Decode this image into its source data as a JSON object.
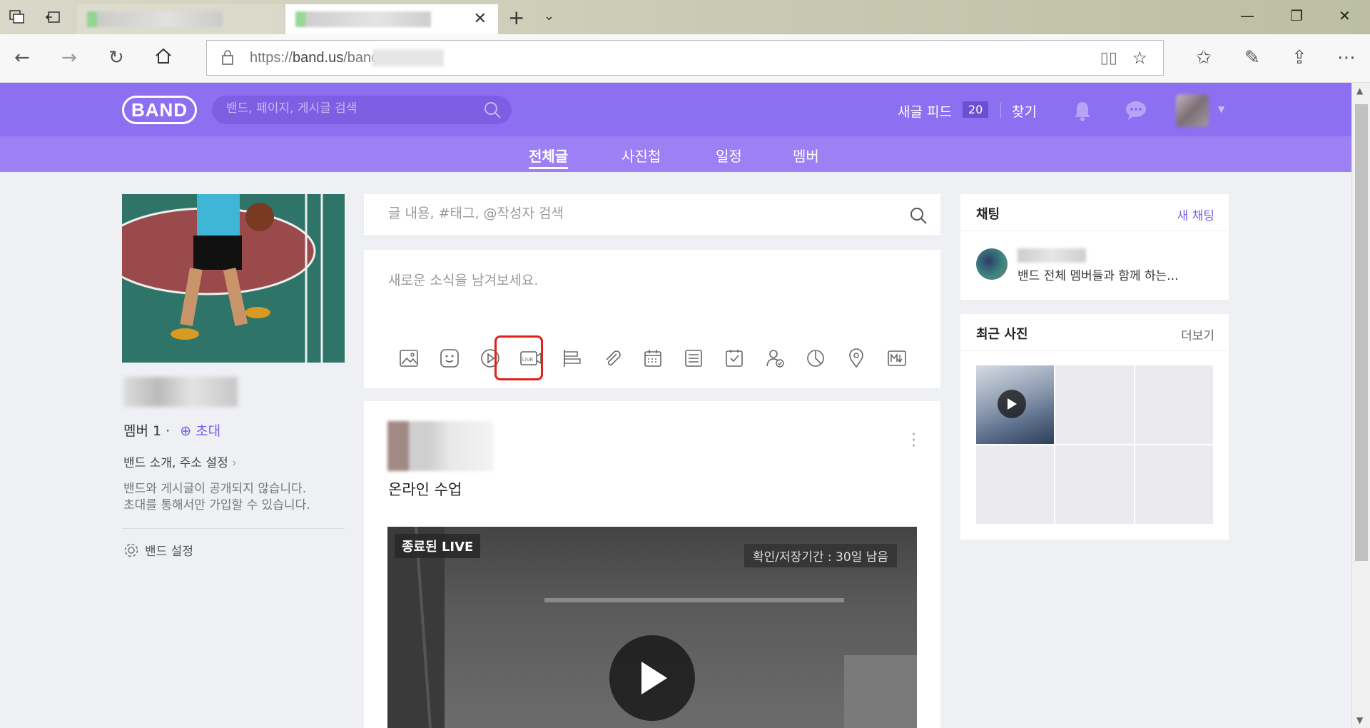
{
  "browser": {
    "url_prefix": "https://",
    "url_host": "band.us",
    "url_path": "/banc"
  },
  "band": {
    "logo": "BAND",
    "search_placeholder": "밴드, 페이지, 게시글 검색",
    "feed_label": "새글 피드",
    "feed_count": "20",
    "find_label": "찾기"
  },
  "subnav": {
    "tabs": [
      "전체글",
      "사진첩",
      "일정",
      "멤버"
    ],
    "active": "전체글"
  },
  "left": {
    "member_label": "멤버 1 ·",
    "invite_label": "초대",
    "intro_link": "밴드 소개, 주소 설정",
    "privacy_line1": "밴드와 게시글이 공개되지 않습니다.",
    "privacy_line2": "초대를 통해서만 가입할 수 있습니다.",
    "settings_label": "밴드 설정"
  },
  "center": {
    "post_search_placeholder": "글 내용, #태그, @작성자 검색",
    "composer_prompt": "새로운 소식을 남겨보세요.",
    "tools": [
      "image-icon",
      "sticker-icon",
      "video-icon",
      "live-icon",
      "text-style-icon",
      "attachment-icon",
      "calendar-icon",
      "checklist-icon",
      "todo-icon",
      "attendance-icon",
      "poll-icon",
      "location-icon",
      "markdown-icon"
    ],
    "post": {
      "title": "온라인 수업",
      "ended_badge": "종료된 LIVE",
      "expire_text": "확인/저장기간 : 30일 남음"
    }
  },
  "right": {
    "chat_title": "채팅",
    "new_chat": "새 채팅",
    "chat_desc": "밴드 전체 멤버들과 함께 하는...",
    "photos_title": "최근 사진",
    "photos_more": "더보기"
  },
  "colors": {
    "band_purple": "#8d6ff1",
    "subnav_purple": "#9c80f4",
    "accent": "#7c5cf0",
    "highlight_red": "#e0201a"
  }
}
